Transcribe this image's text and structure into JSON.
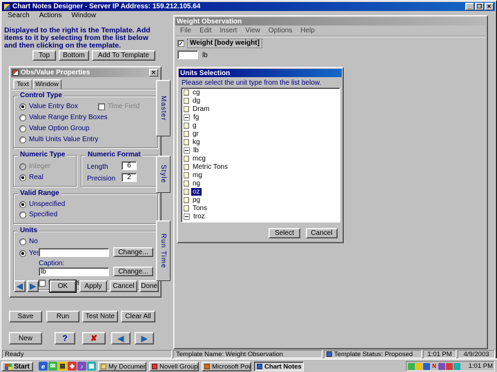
{
  "window": {
    "title": "Chart Notes Designer - Server IP Address: 159.212.105.64",
    "menu": [
      "Search",
      "Actions",
      "Window"
    ]
  },
  "icons": {
    "minimize": "_",
    "maximize": "❐",
    "close": "✕",
    "back": "◀",
    "forward": "▶",
    "delete": "✘",
    "check": "✓"
  },
  "left_panel": {
    "instructions": "Displayed to the right is the Template.  Add items to it by selecting from the list below and then clicking on the template.",
    "top_button": "Top",
    "bottom_button": "Bottom",
    "add_button": "Add To Template",
    "save_button": "Save",
    "run_button": "Run",
    "test_note_button": "Test Note",
    "clear_all_button": "Clear All",
    "new_button": "New",
    "help_button": "?"
  },
  "props_dialog": {
    "title": "Obs/Value Properties",
    "tabs": [
      "Text",
      "Window"
    ],
    "control_type": {
      "title": "Control Type",
      "opt1": "Value Entry Box",
      "opt2": "Value Range Entry Boxes",
      "opt3": "Value Option Group",
      "opt4": "Multi Units Value Entry",
      "time_field": "Time Field"
    },
    "numeric_type": {
      "title": "Numeric Type",
      "opt1": "Integer",
      "opt2": "Real"
    },
    "numeric_format": {
      "title": "Numeric Format",
      "length_label": "Length",
      "length_value": "6",
      "precision_label": "Precision",
      "precision_value": "2"
    },
    "valid_range": {
      "title": "Valid Range",
      "opt1": "Unspecified",
      "opt2": "Specified"
    },
    "units": {
      "title": "Units",
      "no_label": "No",
      "yes_label": "Yes",
      "units_value": "",
      "change_button": "Change...",
      "caption_label": "Caption:",
      "caption_value": "lb",
      "hide_units": "Hide Units"
    },
    "ok_button": "OK",
    "apply_button": "Apply",
    "cancel_button": "Cancel",
    "done_button": "Done"
  },
  "side_tabs": [
    "Master",
    "Style",
    "Run Time"
  ],
  "weight_window": {
    "title": "Weight Observation",
    "menu": [
      "File",
      "Edit",
      "Insert",
      "View",
      "Options",
      "Help"
    ],
    "field_label": "Weight [body weight]",
    "value": "",
    "unit": "lb",
    "units_dialog": {
      "title": "Units Selection",
      "instructions": "Please select the unit type from the list below.",
      "items": [
        {
          "label": "cg",
          "marker": "icon"
        },
        {
          "label": "dg",
          "marker": "icon"
        },
        {
          "label": "Dram",
          "marker": "icon"
        },
        {
          "label": "fg",
          "marker": "minus"
        },
        {
          "label": "g",
          "marker": "icon"
        },
        {
          "label": "gr",
          "marker": "icon"
        },
        {
          "label": "kg",
          "marker": "icon"
        },
        {
          "label": "lb",
          "marker": "minus"
        },
        {
          "label": "mcg",
          "marker": "icon"
        },
        {
          "label": "Metric Tons",
          "marker": "icon"
        },
        {
          "label": "mg",
          "marker": "icon"
        },
        {
          "label": "ng",
          "marker": "icon"
        },
        {
          "label": "oz",
          "marker": "icon",
          "selected": true
        },
        {
          "label": "pg",
          "marker": "icon"
        },
        {
          "label": "Tons",
          "marker": "icon"
        },
        {
          "label": "troz",
          "marker": "minus"
        }
      ],
      "select_button": "Select",
      "cancel_button": "Cancel"
    }
  },
  "status_bar": {
    "ready": "Ready",
    "template_name": "Template Name: Weight Observation",
    "template_status": "Template Status: Proposed",
    "time": "1:01 PM",
    "date": "4/9/2003"
  },
  "taskbar": {
    "start": "Start",
    "tasks": [
      "My Documents",
      "Novell GroupW...",
      "Microsoft Pow...",
      "Chart Notes ..."
    ],
    "clock": "1:01 PM"
  },
  "colors": {
    "accent": "#000080",
    "titlebar_active": "#1668c8",
    "titlebar_inactive": "#808080",
    "selection": "#000080"
  }
}
